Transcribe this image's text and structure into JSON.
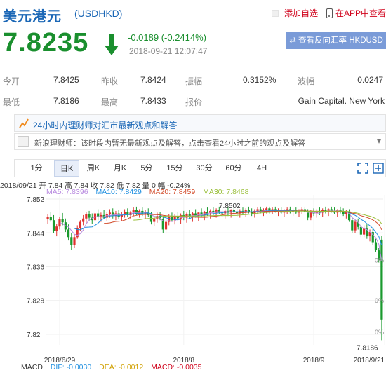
{
  "header": {
    "title": "美元港元",
    "code": "(USDHKD)",
    "add_label": "添加自选",
    "app_label": "在APP中查看"
  },
  "quote": {
    "price": "7.8235",
    "change": "-0.0189 (-0.2414%)",
    "datetime": "2018-09-21 12:07:47",
    "reverse_label": "查看反向汇率 HKDUSD"
  },
  "stats": {
    "open_label": "今开",
    "open": "7.8425",
    "prev_close_label": "昨收",
    "prev_close": "7.8424",
    "amplitude_label": "振幅",
    "amplitude": "0.3152%",
    "volatility_label": "波幅",
    "volatility": "0.0247",
    "low_label": "最低",
    "low": "7.8186",
    "high_label": "最高",
    "high": "7.8433",
    "quoter_label": "报价",
    "quoter": "Gain Capital. New York"
  },
  "expert": {
    "title": "24小时内理财师对汇市最新观点和解答",
    "message": "新浪理财师：该时段内暂无最新观点及解答，点击查看24小时之前的观点及解答"
  },
  "tabs": [
    "1分",
    "日K",
    "周K",
    "月K",
    "5分",
    "15分",
    "30分",
    "60分",
    "4H"
  ],
  "active_tab": "日K",
  "chart_info": {
    "ohlc": "2018/09/21 开 7.84 高 7.84 收 7.82 低 7.82 量 0 幅 -0.24%",
    "ma5": "MA5: 7.8396",
    "ma10": "MA10: 7.8429",
    "ma20": "MA20: 7.8459",
    "ma30": "MA30: 7.8468",
    "macd_label": "MACD",
    "dif": "DIF: -0.0030",
    "dea": "DEA: -0.0012",
    "macd": "MACD: -0.0035"
  },
  "colors": {
    "up": "#e0312f",
    "down": "#1a9a2e",
    "ma5": "#b98be0",
    "ma10": "#1e8fe0",
    "ma20": "#d24b2a",
    "ma30": "#9abf3a",
    "accent": "#1b67b6"
  },
  "chart_data": {
    "type": "candlestick",
    "y_ticks": [
      "7.852",
      "7.844",
      "7.836",
      "7.828",
      "7.82"
    ],
    "ylim": [
      7.8175,
      7.853
    ],
    "x_ticks": [
      "2018/6/29",
      "2018/8",
      "2018/9",
      "2018/9/21"
    ],
    "x_tick_index": [
      4,
      46,
      90,
      114
    ],
    "annotations": {
      "high": "7.8502",
      "low": "7.8186"
    },
    "right_labels": [
      "0%",
      "0%",
      "0%"
    ],
    "candles": [
      {
        "o": 7.8472,
        "h": 7.8484,
        "l": 7.8462,
        "c": 7.8478
      },
      {
        "o": 7.8478,
        "h": 7.849,
        "l": 7.8466,
        "c": 7.847
      },
      {
        "o": 7.847,
        "h": 7.8482,
        "l": 7.844,
        "c": 7.8445
      },
      {
        "o": 7.8445,
        "h": 7.8462,
        "l": 7.8432,
        "c": 7.8455
      },
      {
        "o": 7.8455,
        "h": 7.8478,
        "l": 7.8448,
        "c": 7.8472
      },
      {
        "o": 7.8472,
        "h": 7.8487,
        "l": 7.8458,
        "c": 7.8465
      },
      {
        "o": 7.8465,
        "h": 7.8474,
        "l": 7.8442,
        "c": 7.8448
      },
      {
        "o": 7.8448,
        "h": 7.846,
        "l": 7.8422,
        "c": 7.843
      },
      {
        "o": 7.843,
        "h": 7.844,
        "l": 7.84,
        "c": 7.8412
      },
      {
        "o": 7.8412,
        "h": 7.8436,
        "l": 7.8404,
        "c": 7.843
      },
      {
        "o": 7.843,
        "h": 7.8458,
        "l": 7.8426,
        "c": 7.8452
      },
      {
        "o": 7.8452,
        "h": 7.847,
        "l": 7.8444,
        "c": 7.8466
      },
      {
        "o": 7.8466,
        "h": 7.8482,
        "l": 7.8458,
        "c": 7.8474
      },
      {
        "o": 7.8474,
        "h": 7.849,
        "l": 7.8464,
        "c": 7.8484
      },
      {
        "o": 7.8484,
        "h": 7.8492,
        "l": 7.8468,
        "c": 7.8476
      },
      {
        "o": 7.8476,
        "h": 7.8486,
        "l": 7.8462,
        "c": 7.847
      },
      {
        "o": 7.847,
        "h": 7.849,
        "l": 7.8466,
        "c": 7.8486
      },
      {
        "o": 7.8486,
        "h": 7.8496,
        "l": 7.847,
        "c": 7.8478
      },
      {
        "o": 7.8478,
        "h": 7.8488,
        "l": 7.8466,
        "c": 7.8482
      },
      {
        "o": 7.8482,
        "h": 7.8494,
        "l": 7.8472,
        "c": 7.8476
      },
      {
        "o": 7.8476,
        "h": 7.849,
        "l": 7.8468,
        "c": 7.8484
      },
      {
        "o": 7.8484,
        "h": 7.8496,
        "l": 7.8476,
        "c": 7.8488
      },
      {
        "o": 7.8488,
        "h": 7.8498,
        "l": 7.8474,
        "c": 7.848
      },
      {
        "o": 7.848,
        "h": 7.8492,
        "l": 7.847,
        "c": 7.8486
      },
      {
        "o": 7.8486,
        "h": 7.8494,
        "l": 7.8472,
        "c": 7.8478
      },
      {
        "o": 7.8478,
        "h": 7.849,
        "l": 7.8468,
        "c": 7.8484
      },
      {
        "o": 7.8484,
        "h": 7.8496,
        "l": 7.8476,
        "c": 7.849
      },
      {
        "o": 7.849,
        "h": 7.8498,
        "l": 7.8478,
        "c": 7.8482
      },
      {
        "o": 7.8482,
        "h": 7.8492,
        "l": 7.8472,
        "c": 7.8488
      },
      {
        "o": 7.8488,
        "h": 7.85,
        "l": 7.848,
        "c": 7.8494
      },
      {
        "o": 7.8494,
        "h": 7.8502,
        "l": 7.8482,
        "c": 7.8486
      },
      {
        "o": 7.8486,
        "h": 7.8496,
        "l": 7.8476,
        "c": 7.8492
      },
      {
        "o": 7.8492,
        "h": 7.85,
        "l": 7.848,
        "c": 7.8484
      },
      {
        "o": 7.8484,
        "h": 7.8494,
        "l": 7.8474,
        "c": 7.849
      },
      {
        "o": 7.849,
        "h": 7.8498,
        "l": 7.8478,
        "c": 7.8482
      },
      {
        "o": 7.8482,
        "h": 7.849,
        "l": 7.846,
        "c": 7.8466
      },
      {
        "o": 7.8466,
        "h": 7.848,
        "l": 7.8456,
        "c": 7.8474
      },
      {
        "o": 7.8474,
        "h": 7.8488,
        "l": 7.8464,
        "c": 7.848
      },
      {
        "o": 7.848,
        "h": 7.849,
        "l": 7.847,
        "c": 7.8472
      },
      {
        "o": 7.8472,
        "h": 7.848,
        "l": 7.844,
        "c": 7.8448
      },
      {
        "o": 7.8448,
        "h": 7.8472,
        "l": 7.844,
        "c": 7.8466
      },
      {
        "o": 7.8466,
        "h": 7.8484,
        "l": 7.8458,
        "c": 7.8478
      },
      {
        "o": 7.8478,
        "h": 7.8488,
        "l": 7.8466,
        "c": 7.847
      },
      {
        "o": 7.847,
        "h": 7.8484,
        "l": 7.846,
        "c": 7.848
      },
      {
        "o": 7.848,
        "h": 7.849,
        "l": 7.847,
        "c": 7.8474
      },
      {
        "o": 7.8474,
        "h": 7.8486,
        "l": 7.8462,
        "c": 7.8482
      },
      {
        "o": 7.8482,
        "h": 7.8492,
        "l": 7.847,
        "c": 7.8476
      },
      {
        "o": 7.8476,
        "h": 7.8488,
        "l": 7.8464,
        "c": 7.8484
      },
      {
        "o": 7.8484,
        "h": 7.8494,
        "l": 7.8472,
        "c": 7.8478
      },
      {
        "o": 7.8478,
        "h": 7.849,
        "l": 7.8466,
        "c": 7.8486
      },
      {
        "o": 7.8486,
        "h": 7.8496,
        "l": 7.8476,
        "c": 7.848
      },
      {
        "o": 7.848,
        "h": 7.849,
        "l": 7.8468,
        "c": 7.8488
      },
      {
        "o": 7.8488,
        "h": 7.8498,
        "l": 7.8478,
        "c": 7.8482
      },
      {
        "o": 7.8482,
        "h": 7.8492,
        "l": 7.847,
        "c": 7.849
      },
      {
        "o": 7.849,
        "h": 7.85,
        "l": 7.848,
        "c": 7.8486
      },
      {
        "o": 7.8486,
        "h": 7.8496,
        "l": 7.8474,
        "c": 7.8492
      },
      {
        "o": 7.8492,
        "h": 7.85,
        "l": 7.8482,
        "c": 7.8488
      },
      {
        "o": 7.8488,
        "h": 7.8498,
        "l": 7.8476,
        "c": 7.8494
      },
      {
        "o": 7.8494,
        "h": 7.8502,
        "l": 7.8484,
        "c": 7.849
      },
      {
        "o": 7.849,
        "h": 7.8498,
        "l": 7.8478,
        "c": 7.8486
      },
      {
        "o": 7.8486,
        "h": 7.8496,
        "l": 7.8474,
        "c": 7.8492
      },
      {
        "o": 7.8492,
        "h": 7.85,
        "l": 7.848,
        "c": 7.8488
      },
      {
        "o": 7.8488,
        "h": 7.8496,
        "l": 7.8476,
        "c": 7.8494
      },
      {
        "o": 7.8494,
        "h": 7.8502,
        "l": 7.8484,
        "c": 7.849
      },
      {
        "o": 7.849,
        "h": 7.8498,
        "l": 7.8478,
        "c": 7.8486
      },
      {
        "o": 7.8486,
        "h": 7.8496,
        "l": 7.8476,
        "c": 7.8492
      },
      {
        "o": 7.8492,
        "h": 7.85,
        "l": 7.8482,
        "c": 7.8488
      },
      {
        "o": 7.8488,
        "h": 7.8498,
        "l": 7.8478,
        "c": 7.8494
      },
      {
        "o": 7.8494,
        "h": 7.8502,
        "l": 7.8486,
        "c": 7.849
      },
      {
        "o": 7.849,
        "h": 7.8498,
        "l": 7.848,
        "c": 7.8486
      },
      {
        "o": 7.8486,
        "h": 7.8496,
        "l": 7.8476,
        "c": 7.8492
      },
      {
        "o": 7.8492,
        "h": 7.85,
        "l": 7.8484,
        "c": 7.8496
      },
      {
        "o": 7.8496,
        "h": 7.8502,
        "l": 7.8486,
        "c": 7.849
      },
      {
        "o": 7.849,
        "h": 7.8498,
        "l": 7.848,
        "c": 7.8494
      },
      {
        "o": 7.8494,
        "h": 7.8502,
        "l": 7.8486,
        "c": 7.8498
      },
      {
        "o": 7.8498,
        "h": 7.8502,
        "l": 7.8486,
        "c": 7.8492
      },
      {
        "o": 7.8492,
        "h": 7.85,
        "l": 7.8484,
        "c": 7.8496
      },
      {
        "o": 7.8496,
        "h": 7.8502,
        "l": 7.8488,
        "c": 7.849
      },
      {
        "o": 7.849,
        "h": 7.8498,
        "l": 7.848,
        "c": 7.8494
      },
      {
        "o": 7.8494,
        "h": 7.85,
        "l": 7.8484,
        "c": 7.8488
      },
      {
        "o": 7.8488,
        "h": 7.8496,
        "l": 7.8478,
        "c": 7.8492
      },
      {
        "o": 7.8492,
        "h": 7.85,
        "l": 7.8484,
        "c": 7.8496
      },
      {
        "o": 7.8496,
        "h": 7.8502,
        "l": 7.8486,
        "c": 7.849
      },
      {
        "o": 7.849,
        "h": 7.8498,
        "l": 7.848,
        "c": 7.8494
      },
      {
        "o": 7.8494,
        "h": 7.85,
        "l": 7.8484,
        "c": 7.8488
      },
      {
        "o": 7.8488,
        "h": 7.8496,
        "l": 7.8478,
        "c": 7.8492
      },
      {
        "o": 7.8492,
        "h": 7.85,
        "l": 7.8484,
        "c": 7.8496
      },
      {
        "o": 7.8496,
        "h": 7.8502,
        "l": 7.8488,
        "c": 7.849
      },
      {
        "o": 7.849,
        "h": 7.8496,
        "l": 7.847,
        "c": 7.8476
      },
      {
        "o": 7.8476,
        "h": 7.8494,
        "l": 7.847,
        "c": 7.849
      },
      {
        "o": 7.849,
        "h": 7.8498,
        "l": 7.848,
        "c": 7.8486
      },
      {
        "o": 7.8486,
        "h": 7.8496,
        "l": 7.8476,
        "c": 7.8492
      },
      {
        "o": 7.8492,
        "h": 7.85,
        "l": 7.8482,
        "c": 7.8488
      },
      {
        "o": 7.8488,
        "h": 7.8498,
        "l": 7.8478,
        "c": 7.8494
      },
      {
        "o": 7.8494,
        "h": 7.8502,
        "l": 7.8486,
        "c": 7.849
      },
      {
        "o": 7.849,
        "h": 7.8498,
        "l": 7.848,
        "c": 7.8496
      },
      {
        "o": 7.8496,
        "h": 7.8502,
        "l": 7.8488,
        "c": 7.8492
      },
      {
        "o": 7.8492,
        "h": 7.85,
        "l": 7.8484,
        "c": 7.8488
      },
      {
        "o": 7.8488,
        "h": 7.8496,
        "l": 7.8478,
        "c": 7.8494
      },
      {
        "o": 7.8494,
        "h": 7.8502,
        "l": 7.8486,
        "c": 7.849
      },
      {
        "o": 7.849,
        "h": 7.8498,
        "l": 7.848,
        "c": 7.8484
      },
      {
        "o": 7.8484,
        "h": 7.8494,
        "l": 7.8474,
        "c": 7.849
      },
      {
        "o": 7.849,
        "h": 7.8496,
        "l": 7.8466,
        "c": 7.847
      },
      {
        "o": 7.847,
        "h": 7.8478,
        "l": 7.844,
        "c": 7.8446
      },
      {
        "o": 7.8446,
        "h": 7.847,
        "l": 7.844,
        "c": 7.8466
      },
      {
        "o": 7.8466,
        "h": 7.8474,
        "l": 7.8448,
        "c": 7.8454
      },
      {
        "o": 7.8454,
        "h": 7.8462,
        "l": 7.843,
        "c": 7.8436
      },
      {
        "o": 7.8436,
        "h": 7.8458,
        "l": 7.843,
        "c": 7.845
      },
      {
        "o": 7.845,
        "h": 7.846,
        "l": 7.8426,
        "c": 7.8432
      },
      {
        "o": 7.8432,
        "h": 7.8448,
        "l": 7.842,
        "c": 7.8442
      },
      {
        "o": 7.8442,
        "h": 7.845,
        "l": 7.8412,
        "c": 7.8418
      },
      {
        "o": 7.8418,
        "h": 7.8426,
        "l": 7.8394,
        "c": 7.84
      },
      {
        "o": 7.84,
        "h": 7.8404,
        "l": 7.837,
        "c": 7.8376
      },
      {
        "o": 7.8424,
        "h": 7.8433,
        "l": 7.8186,
        "c": 7.8235
      }
    ]
  }
}
